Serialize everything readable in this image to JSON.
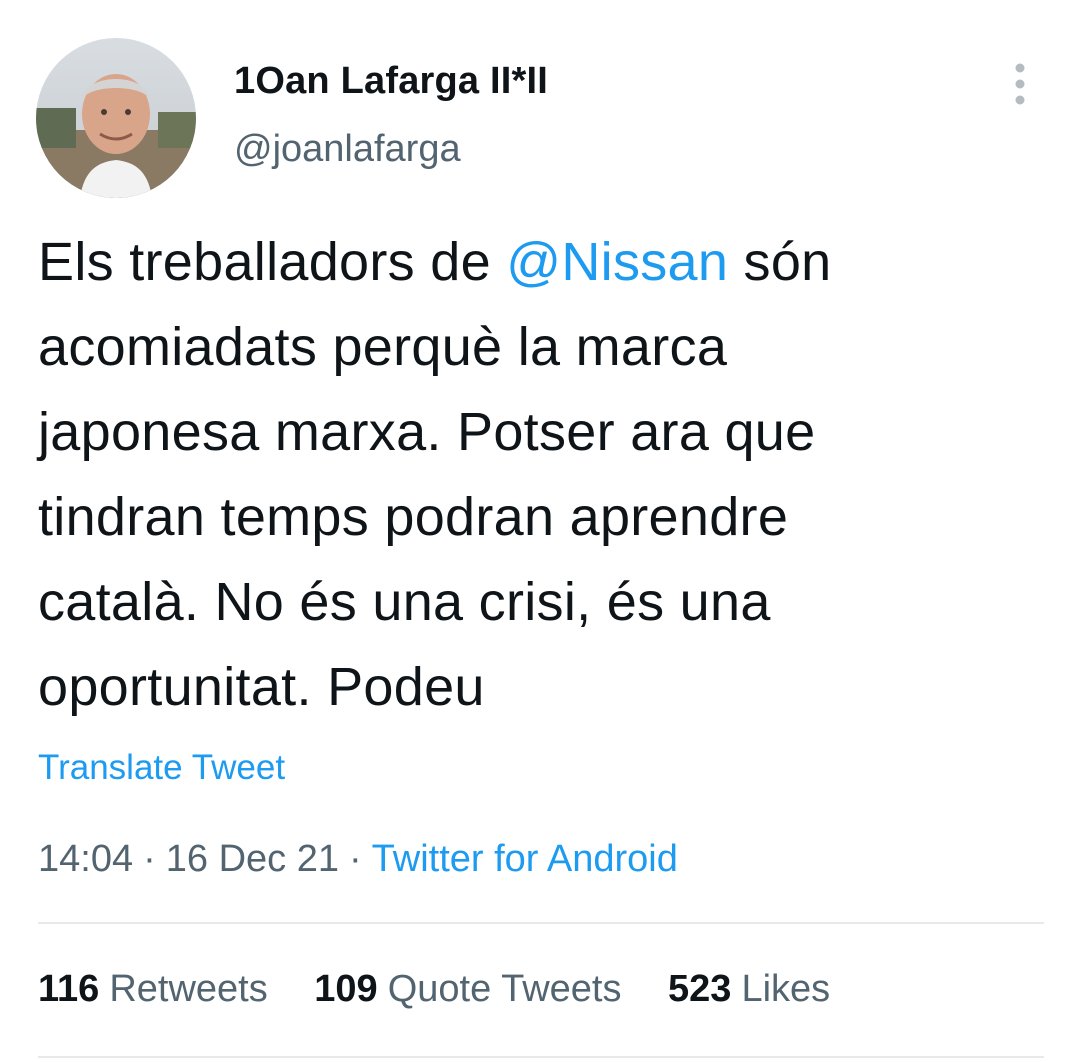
{
  "author": {
    "display_name": "1Oan Lafarga II*II",
    "handle": "@joanlafarga",
    "avatar_icon": "profile-photo"
  },
  "tweet": {
    "lines": [
      {
        "pre": "Els treballadors de ",
        "mention": "@Nissan",
        "post": " són"
      },
      {
        "text": "acomiadats perquè la marca"
      },
      {
        "text": "japonesa marxa. Potser ara que"
      },
      {
        "text": "tindran temps podran aprendre"
      },
      {
        "text": "català. No és una crisi, és una"
      },
      {
        "text": "oportunitat. Podeu"
      }
    ]
  },
  "translate_label": "Translate Tweet",
  "meta": {
    "time": "14:04",
    "date": "16 Dec 21",
    "separator": "·",
    "source": "Twitter for Android"
  },
  "stats": {
    "retweets": {
      "count": "116",
      "label": "Retweets"
    },
    "quotes": {
      "count": "109",
      "label": "Quote Tweets"
    },
    "likes": {
      "count": "523",
      "label": "Likes"
    }
  },
  "colors": {
    "accent": "#1d9bf0",
    "text": "#0f1419",
    "secondary": "#536471",
    "divider": "#e7e9ea"
  }
}
